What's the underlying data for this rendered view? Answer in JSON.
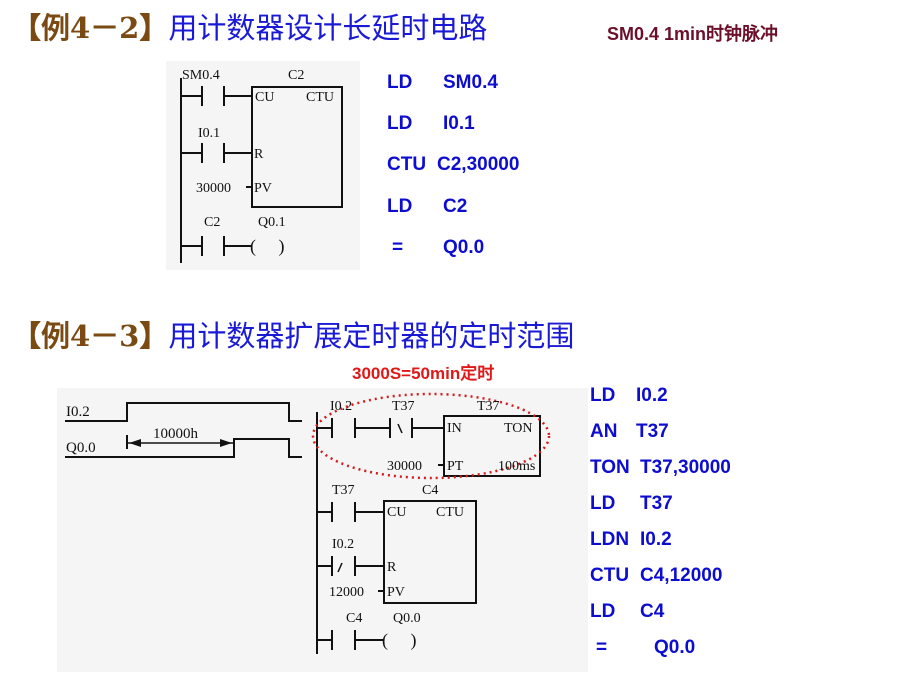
{
  "example1": {
    "tag": "【例4－2】",
    "title": "用计数器设计长延时电路",
    "note": "SM0.4  1min时钟脉冲",
    "ladder": {
      "rung1_contact": "SM0.4",
      "counter_name": "C2",
      "counter_cu": "CU",
      "counter_type": "CTU",
      "rung2_contact": "I0.1",
      "counter_r": "R",
      "preset_value": "30000",
      "counter_pv": "PV",
      "rung3_contact": "C2",
      "output_coil": "Q0.1",
      "coil_symbol": "(     )"
    },
    "instructions": [
      {
        "op": "LD",
        "arg": "SM0.4"
      },
      {
        "op": "LD",
        "arg": "I0.1"
      },
      {
        "op": "CTU",
        "arg": "C2,30000"
      },
      {
        "op": "LD",
        "arg": "C2"
      },
      {
        "op": "=",
        "arg": "Q0.0"
      }
    ]
  },
  "example2": {
    "tag": "【例4－3】",
    "title": "用计数器扩展定时器的定时范围",
    "note": "3000S=50min定时",
    "timing": {
      "signal1": "I0.2",
      "signal2": "Q0.0",
      "duration": "10000h"
    },
    "ladder": {
      "rung1_contact1": "I0.2",
      "rung1_contact2": "T37",
      "timer_name": "T37",
      "timer_in": "IN",
      "timer_type": "TON",
      "timer_preset": "30000",
      "timer_pt": "PT",
      "timer_base": "100ms",
      "rung2_contact": "T37",
      "counter_name": "C4",
      "counter_cu": "CU",
      "counter_type": "CTU",
      "rung3_contact": "I0.2",
      "counter_r": "R",
      "counter_preset": "12000",
      "counter_pv": "PV",
      "rung4_contact": "C4",
      "output_coil": "Q0.0",
      "coil_symbol": "(     )"
    },
    "instructions": [
      {
        "op": "LD",
        "arg": "I0.2"
      },
      {
        "op": "AN",
        "arg": "T37"
      },
      {
        "op": "TON",
        "arg": "T37,30000"
      },
      {
        "op": "LD",
        "arg": "T37"
      },
      {
        "op": "LDN",
        "arg": "I0.2"
      },
      {
        "op": "CTU",
        "arg": "C4,12000"
      },
      {
        "op": "LD",
        "arg": "C4"
      },
      {
        "op": "=",
        "arg": "Q0.0"
      }
    ]
  }
}
